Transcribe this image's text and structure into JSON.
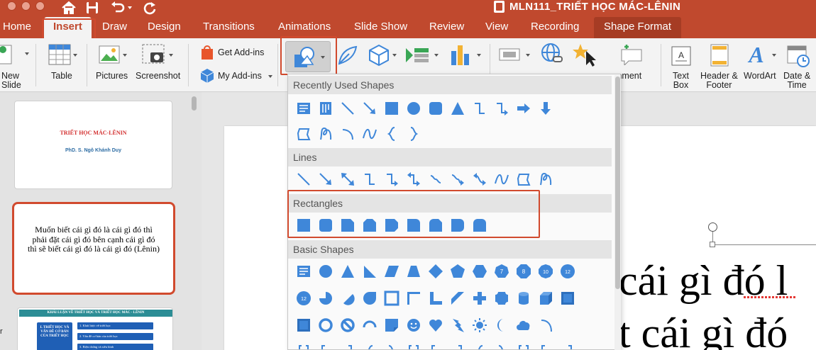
{
  "window": {
    "title": "MLN111_TRIẾT HỌC MÁC-LÊNIN",
    "quick_access": [
      "home-icon",
      "save-icon",
      "undo-icon",
      "redo-icon"
    ]
  },
  "tabs": [
    "Home",
    "Insert",
    "Draw",
    "Design",
    "Transitions",
    "Animations",
    "Slide Show",
    "Review",
    "View",
    "Recording",
    "Shape Format"
  ],
  "active_tab": "Insert",
  "ribbon": {
    "new_slide": "New\nSlide",
    "table": "Table",
    "pictures": "Pictures",
    "screenshot": "Screenshot",
    "get_addins": "Get Add-ins",
    "my_addins": "My Add-ins",
    "comment": "mment",
    "text_box": "Text\nBox",
    "header_footer": "Header &\nFooter",
    "wordart": "WordArt",
    "date_time": "Date &\nTime"
  },
  "shapes_menu": {
    "sections": [
      "Recently Used Shapes",
      "Lines",
      "Rectangles",
      "Basic Shapes"
    ]
  },
  "thumbnails": {
    "slide1": {
      "title": "TRIẾT HỌC MÁC-LÊNIN",
      "author": "PhD. S. Ngô Khánh Duy"
    },
    "slide2": {
      "quote": "Muốn biết cái gì đó là cái gì đó thì phải đặt cái gì đó bên cạnh cái gì đó thì sẽ biết cái gì đó là cái gì đó (Lênin)"
    },
    "slide3": {
      "header": "KHÁI LUẬN VỀ TRIẾT HỌC VÀ TRIẾT HỌC MÁC - LÊNIN",
      "box": "I. TRIẾT HỌC VÀ VẤN ĐỀ CƠ BẢN CỦA TRIẾT HỌC",
      "items": [
        "1. Khái lược về triết học",
        "2. Vấn đề cơ bản của triết học",
        "3. Biện chứng và siêu hình"
      ],
      "marker": "r"
    }
  },
  "canvas": {
    "line1": "cái gì đó l",
    "line2": "t cái gì đó"
  },
  "colors": {
    "brand": "#c0492e",
    "shape_blue": "#3f87d9",
    "highlight": "#d14a2e"
  }
}
